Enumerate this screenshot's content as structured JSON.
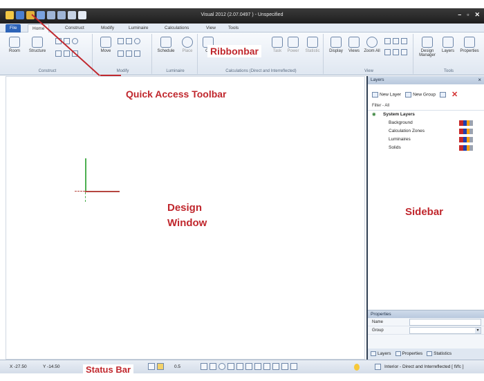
{
  "titlebar": {
    "title": "Visual 2012 (2.07.0497 ) - Unspecified",
    "controls": [
      "–",
      "▫",
      "✕"
    ]
  },
  "tabs": [
    "File",
    "Home",
    "Construct",
    "Modify",
    "Luminaire",
    "Calculations",
    "View",
    "Tools"
  ],
  "ribbon": {
    "groups": {
      "construct": {
        "label": "Construct",
        "buttons": [
          "Room",
          "Structure"
        ]
      },
      "modify": {
        "label": "Modify",
        "buttons": [
          "Move"
        ]
      },
      "luminaire": {
        "label": "Luminaire",
        "buttons": [
          "Schedule",
          "Place"
        ]
      },
      "calculations": {
        "label": "Calculations (Direct and Interreflected)",
        "buttons": [
          "Ca",
          "Task",
          "Power",
          "Statistic"
        ]
      },
      "view": {
        "label": "View",
        "buttons": [
          "Display",
          "Views",
          "Zoom All"
        ]
      },
      "tools": {
        "label": "Tools",
        "buttons": [
          "Design Manager",
          "Layers",
          "Properties"
        ]
      }
    }
  },
  "annotations": {
    "quick_access": "Quick Access Toolbar",
    "ribbonbar": "Ribbonbar",
    "design_window": [
      "Design",
      "Window"
    ],
    "sidebar": "Sidebar",
    "status_bar": "Status Bar"
  },
  "sidebar": {
    "header": "Layers",
    "toolbar": {
      "new_layer": "New Layer",
      "new_group": "New Group"
    },
    "filter": "Filter  - All",
    "group_name": "System Layers",
    "layers": [
      "Background",
      "Calculation Zones",
      "Luminaires",
      "Solids"
    ],
    "properties": {
      "title": "Properties",
      "rows": [
        "Name",
        "Group"
      ]
    },
    "bottom_tabs": [
      "Layers",
      "Properties",
      "Statistics"
    ]
  },
  "statusbar": {
    "x": "X  -27.50",
    "y": "Y  -14.50",
    "snap": "0.5",
    "mode": "Interior - Direct and Interreflected [ fl/fc ]"
  },
  "colors": {
    "annotation": "#c0272d",
    "file_tab": "#2d64b8",
    "titlebar": "#2a2a2a"
  }
}
